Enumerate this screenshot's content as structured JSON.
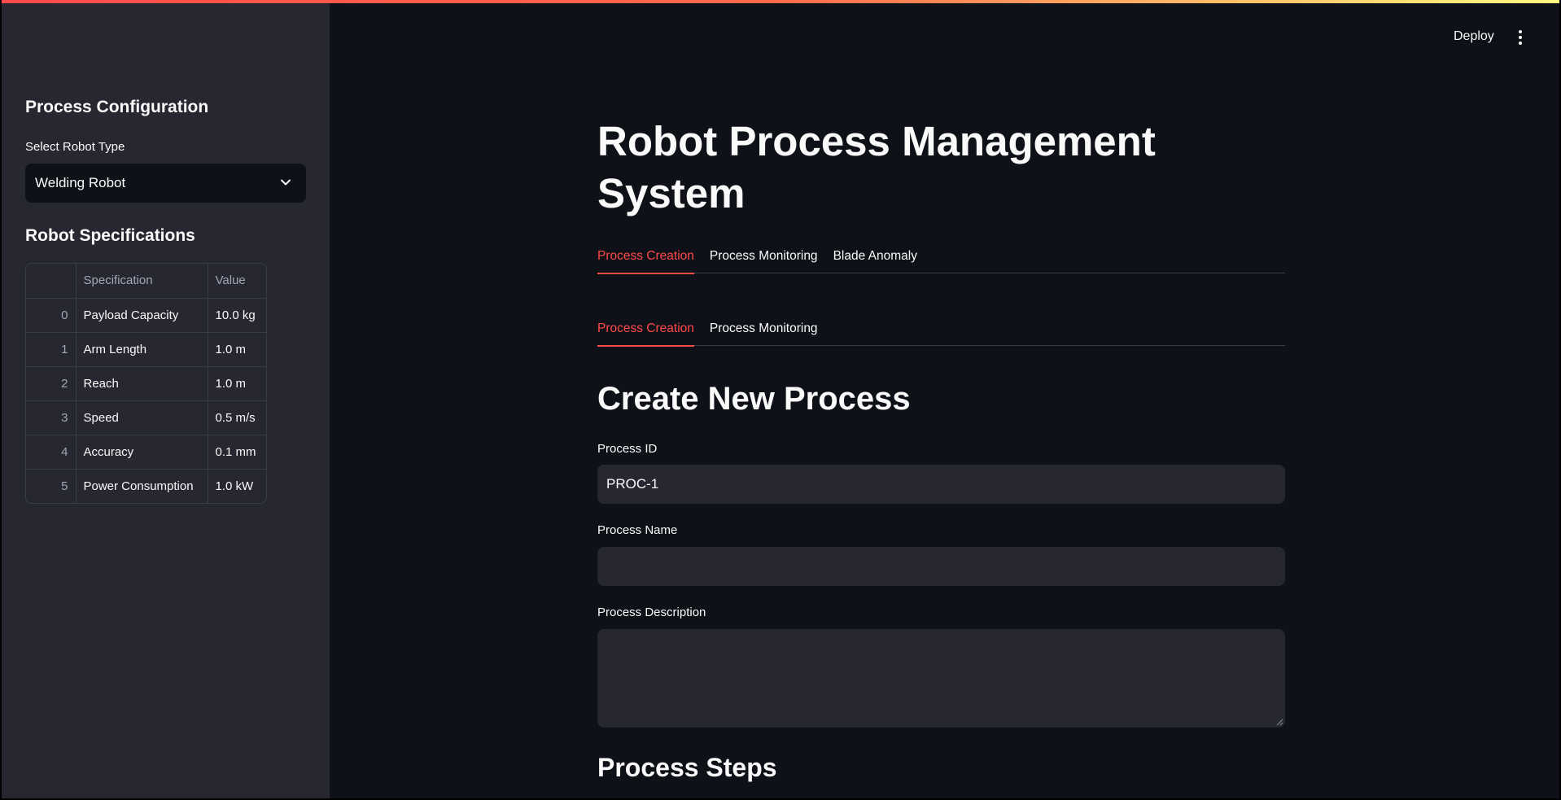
{
  "header": {
    "deploy_label": "Deploy",
    "menu_icon": "vertical-dots-icon"
  },
  "sidebar": {
    "config_heading": "Process Configuration",
    "robot_type_label": "Select Robot Type",
    "robot_type_value": "Welding Robot",
    "specs_heading": "Robot Specifications",
    "table": {
      "columns": [
        "",
        "Specification",
        "Value"
      ],
      "rows": [
        {
          "index": "0",
          "spec": "Payload Capacity",
          "value": "10.0 kg"
        },
        {
          "index": "1",
          "spec": "Arm Length",
          "value": "1.0 m"
        },
        {
          "index": "2",
          "spec": "Reach",
          "value": "1.0 m"
        },
        {
          "index": "3",
          "spec": "Speed",
          "value": "0.5 m/s"
        },
        {
          "index": "4",
          "spec": "Accuracy",
          "value": "0.1 mm"
        },
        {
          "index": "5",
          "spec": "Power Consumption",
          "value": "1.0 kW"
        }
      ]
    }
  },
  "main": {
    "title": "Robot Process Management System",
    "tabs": [
      {
        "label": "Process Creation",
        "active": true
      },
      {
        "label": "Process Monitoring",
        "active": false
      },
      {
        "label": "Blade Anomaly",
        "active": false
      }
    ],
    "subtabs": [
      {
        "label": "Process Creation",
        "active": true
      },
      {
        "label": "Process Monitoring",
        "active": false
      }
    ],
    "create_heading": "Create New Process",
    "process_id_label": "Process ID",
    "process_id_value": "PROC-1",
    "process_name_label": "Process Name",
    "process_name_value": "",
    "process_description_label": "Process Description",
    "process_description_value": "",
    "steps_heading": "Process Steps"
  },
  "colors": {
    "accent": "#ff4b4b",
    "background": "#0e1117",
    "sidebar": "#262730"
  }
}
